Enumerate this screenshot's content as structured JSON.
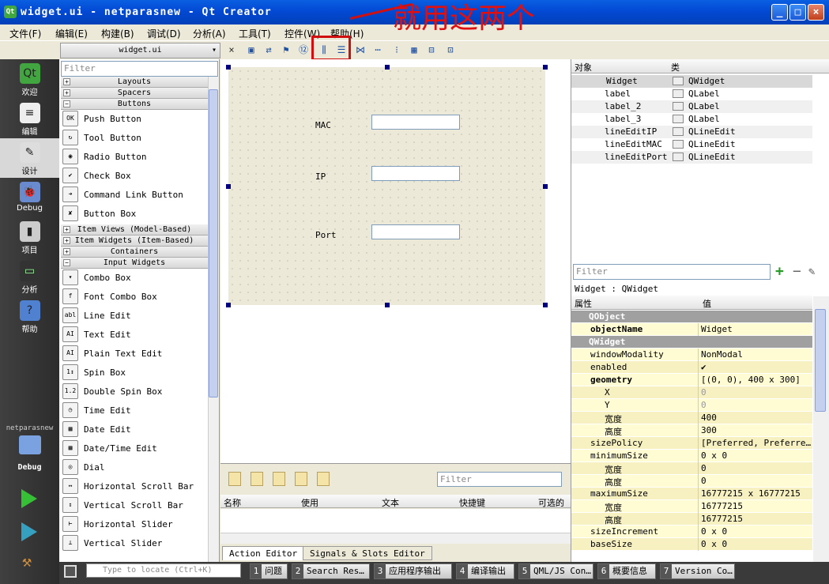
{
  "window": {
    "title": "widget.ui - netparasnew - Qt Creator",
    "icon_text": "Qt",
    "min": "_",
    "max": "□",
    "close": "×"
  },
  "annotation": {
    "text": "就用这两个",
    "color": "#e01010"
  },
  "menu": [
    "文件(F)",
    "编辑(E)",
    "构建(B)",
    "调试(D)",
    "分析(A)",
    "工具(T)",
    "控件(W)",
    "帮助(H)"
  ],
  "toolbar": {
    "doc": "widget.ui",
    "doc_arrow": "▾",
    "close": "×",
    "icons": [
      "edit-widgets-icon",
      "edit-signals-icon",
      "edit-buddies-icon",
      "edit-tab-order-icon",
      "layout-horizontal-icon",
      "layout-vertical-icon",
      "splitter-horizontal-icon",
      "splitter-vertical-icon",
      "layout-form-icon",
      "layout-grid-icon",
      "break-layout-icon",
      "adjust-size-icon"
    ]
  },
  "modes": [
    {
      "label": "欢迎",
      "icon": "Qt"
    },
    {
      "label": "编辑",
      "icon": "≡"
    },
    {
      "label": "设计",
      "icon": "✎"
    },
    {
      "label": "Debug",
      "icon": "🐞"
    },
    {
      "label": "项目",
      "icon": "▮"
    },
    {
      "label": "分析",
      "icon": "▭"
    },
    {
      "label": "帮助",
      "icon": "?"
    }
  ],
  "kit": {
    "project": "netparasnew",
    "label": "Debug"
  },
  "widgetbox": {
    "filter": "Filter",
    "categories": {
      "layouts": "Layouts",
      "spacers": "Spacers",
      "buttons": "Buttons",
      "itemviews": "Item Views (Model-Based)",
      "itemwidgets": "Item Widgets (Item-Based)",
      "containers": "Containers",
      "input": "Input Widgets"
    },
    "buttons": [
      "Push Button",
      "Tool Button",
      "Radio Button",
      "Check Box",
      "Command Link Button",
      "Button Box"
    ],
    "inputs": [
      "Combo Box",
      "Font Combo Box",
      "Line Edit",
      "Text Edit",
      "Plain Text Edit",
      "Spin Box",
      "Double Spin Box",
      "Time Edit",
      "Date Edit",
      "Date/Time Edit",
      "Dial",
      "Horizontal Scroll Bar",
      "Vertical Scroll Bar",
      "Horizontal Slider",
      "Vertical Slider"
    ],
    "button_icons": [
      "OK",
      "↻",
      "◉",
      "✔",
      "➜",
      "✘"
    ],
    "input_icons": [
      "▾",
      "f",
      "abl",
      "AI",
      "AI",
      "1↕",
      "1.2",
      "◷",
      "▦",
      "▦",
      "◎",
      "↔",
      "↕",
      "⊢",
      "⊥"
    ]
  },
  "form": {
    "labels": [
      "MAC",
      "IP",
      "Port"
    ]
  },
  "action_editor": {
    "filter": "Filter",
    "headers": [
      "名称",
      "使用",
      "文本",
      "快捷键",
      "可选的"
    ],
    "tabs": [
      "Action Editor",
      "Signals & Slots Editor"
    ]
  },
  "object_inspector": {
    "headers": [
      "对象",
      "类"
    ],
    "rows": [
      {
        "object": "Widget",
        "class": "QWidget"
      },
      {
        "object": "label",
        "class": "QLabel"
      },
      {
        "object": "label_2",
        "class": "QLabel"
      },
      {
        "object": "label_3",
        "class": "QLabel"
      },
      {
        "object": "lineEditIP",
        "class": "QLineEdit"
      },
      {
        "object": "lineEditMAC",
        "class": "QLineEdit"
      },
      {
        "object": "lineEditPort",
        "class": "QLineEdit"
      }
    ]
  },
  "property_editor": {
    "filter": "Filter",
    "object_label": "Widget : QWidget",
    "headers": [
      "属性",
      "值"
    ],
    "rows": [
      {
        "k": "QObject",
        "v": "",
        "t": "sect"
      },
      {
        "k": "objectName",
        "v": "Widget",
        "t": "y",
        "b": true
      },
      {
        "k": "QWidget",
        "v": "",
        "t": "sect"
      },
      {
        "k": "windowModality",
        "v": "NonModal",
        "t": "y"
      },
      {
        "k": "enabled",
        "v": "✔",
        "t": "y2"
      },
      {
        "k": "geometry",
        "v": "[(0, 0), 400 x 300]",
        "t": "y",
        "b": true
      },
      {
        "k": "X",
        "v": "0",
        "t": "y2",
        "s": true
      },
      {
        "k": "Y",
        "v": "0",
        "t": "y",
        "s": true
      },
      {
        "k": "宽度",
        "v": "400",
        "t": "y2",
        "s": true
      },
      {
        "k": "高度",
        "v": "300",
        "t": "y",
        "s": true
      },
      {
        "k": "sizePolicy",
        "v": "[Preferred, Preferre…",
        "t": "y2"
      },
      {
        "k": "minimumSize",
        "v": "0 x 0",
        "t": "y"
      },
      {
        "k": "宽度",
        "v": "0",
        "t": "y2",
        "s": true
      },
      {
        "k": "高度",
        "v": "0",
        "t": "y",
        "s": true
      },
      {
        "k": "maximumSize",
        "v": "16777215 x 16777215",
        "t": "y2"
      },
      {
        "k": "宽度",
        "v": "16777215",
        "t": "y",
        "s": true
      },
      {
        "k": "高度",
        "v": "16777215",
        "t": "y2",
        "s": true
      },
      {
        "k": "sizeIncrement",
        "v": "0 x 0",
        "t": "y"
      },
      {
        "k": "baseSize",
        "v": "0 x 0",
        "t": "y2"
      }
    ]
  },
  "status": {
    "locate": "Type to locate (Ctrl+K)",
    "panels": [
      {
        "n": "1",
        "t": "问题"
      },
      {
        "n": "2",
        "t": "Search Res…"
      },
      {
        "n": "3",
        "t": "应用程序输出"
      },
      {
        "n": "4",
        "t": "编译输出"
      },
      {
        "n": "5",
        "t": "QML/JS Con…"
      },
      {
        "n": "6",
        "t": "概要信息"
      },
      {
        "n": "7",
        "t": "Version Co…"
      }
    ]
  }
}
